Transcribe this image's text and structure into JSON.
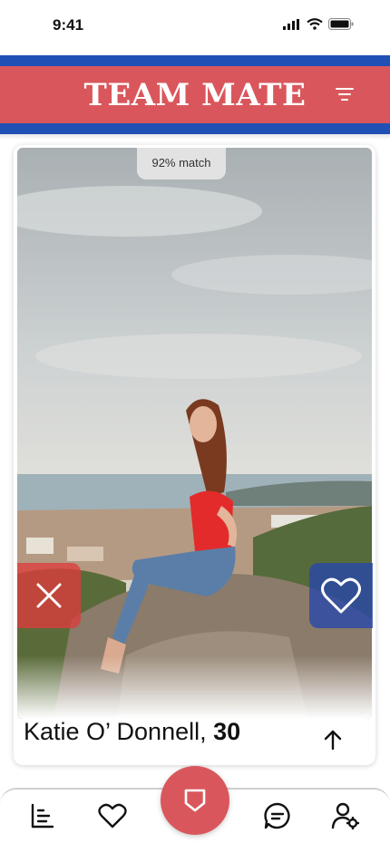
{
  "status_bar": {
    "time": "9:41",
    "icons": [
      "signal-icon",
      "wifi-icon",
      "battery-icon"
    ]
  },
  "header": {
    "title": "TEAM MATE",
    "menu_icon": "filter-menu-icon"
  },
  "colors": {
    "brand_red": "#d9575c",
    "brand_blue": "#2150b4"
  },
  "profile": {
    "match": "92% match",
    "name": "Katie O’ Donnell,",
    "age": "30",
    "actions": {
      "reject_icon": "close-icon",
      "like_icon": "heart-icon",
      "expand_icon": "arrow-up-icon"
    }
  },
  "bottom_nav": {
    "items": [
      {
        "icon": "leaderboard-icon"
      },
      {
        "icon": "heart-icon"
      },
      {
        "icon": "shield-icon",
        "active": true
      },
      {
        "icon": "chat-icon"
      },
      {
        "icon": "user-settings-icon"
      }
    ]
  }
}
